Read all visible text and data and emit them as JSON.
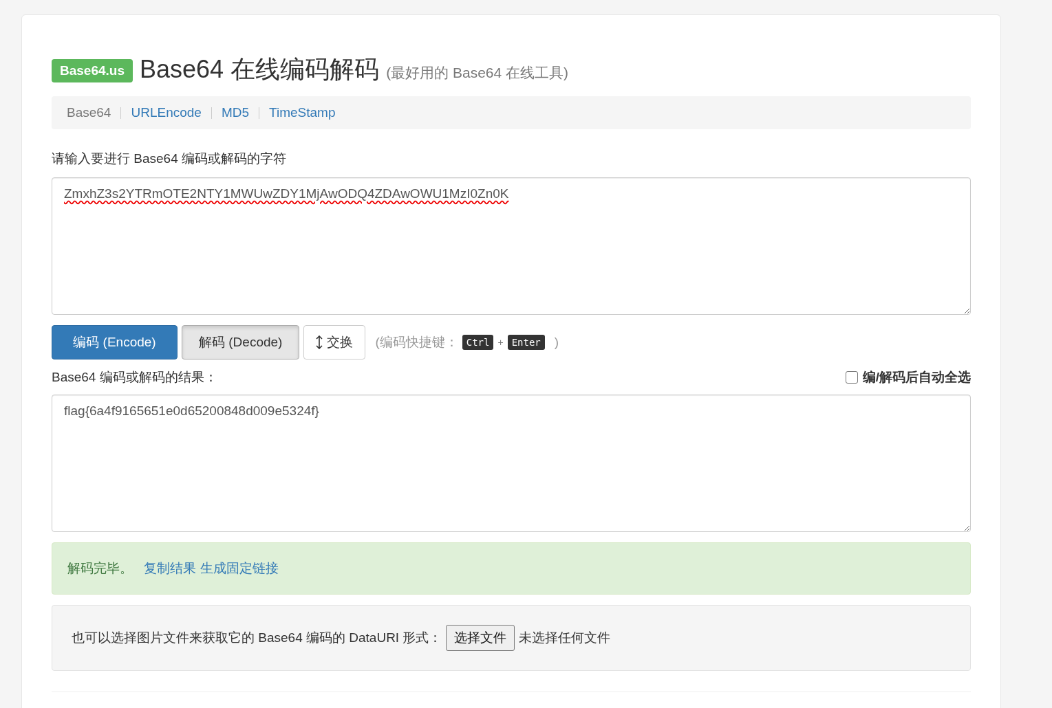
{
  "header": {
    "badge": "Base64.us",
    "title": "Base64 在线编码解码",
    "subtitle": "(最好用的 Base64 在线工具)"
  },
  "nav": [
    {
      "label": "Base64",
      "selected": true
    },
    {
      "label": "URLEncode",
      "selected": false
    },
    {
      "label": "MD5",
      "selected": false
    },
    {
      "label": "TimeStamp",
      "selected": false
    }
  ],
  "input": {
    "label": "请输入要进行 Base64 编码或解码的字符",
    "value": "ZmxhZ3s2YTRmOTE2NTY1MWUwZDY1MjAwODQ4ZDAwOWU1MzI0Zn0K"
  },
  "buttons": [
    {
      "label": "编码 (Encode)",
      "kind": "primary",
      "selected": false
    },
    {
      "label": "解码 (Decode)",
      "kind": "default",
      "selected": true
    },
    {
      "label": "交换",
      "kind": "swap",
      "selected": false
    }
  ],
  "shortcut": {
    "prefix": "(编码快捷键：",
    "keys": [
      "Ctrl",
      "Enter"
    ],
    "joiner": "+",
    "suffix": ")"
  },
  "output": {
    "label": "Base64 编码或解码的结果：",
    "auto_select": {
      "label": "编/解码后自动全选",
      "checked": false
    },
    "value": "flag{6a4f9165651e0d65200848d009e5324f}"
  },
  "alert": {
    "message": "解码完毕。",
    "links": [
      "复制结果",
      "生成固定链接"
    ]
  },
  "file": {
    "label": "也可以选择图片文件来获取它的 Base64 编码的 DataURI 形式：",
    "button": "选择文件",
    "status": "未选择任何文件"
  }
}
